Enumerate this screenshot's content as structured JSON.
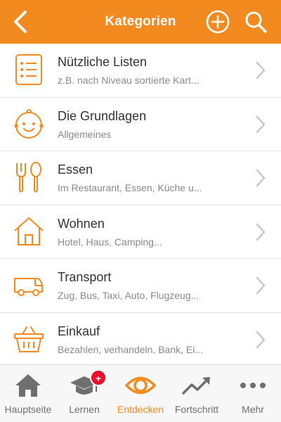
{
  "header": {
    "title": "Kategorien"
  },
  "categories": [
    {
      "title": "Nützliche Listen",
      "subtitle": "z.B. nach Niveau sortierte Kart...",
      "icon": "list-icon"
    },
    {
      "title": "Die Grundlagen",
      "subtitle": "Allgemeines",
      "icon": "baby-face-icon"
    },
    {
      "title": "Essen",
      "subtitle": "Im Restaurant, Essen, Küche u...",
      "icon": "fork-spoon-icon"
    },
    {
      "title": "Wohnen",
      "subtitle": "Hotel, Haus, Camping...",
      "icon": "house-icon"
    },
    {
      "title": "Transport",
      "subtitle": "Zug, Bus, Taxi, Auto, Flugzeug...",
      "icon": "van-icon"
    },
    {
      "title": "Einkauf",
      "subtitle": "Bezahlen, verhandeln, Bank, Ei...",
      "icon": "basket-icon"
    }
  ],
  "tabs": [
    {
      "label": "Hauptseite",
      "icon": "home-icon",
      "active": false
    },
    {
      "label": "Lernen",
      "icon": "graduation-cap-icon",
      "active": false,
      "badge": "+"
    },
    {
      "label": "Entdecken",
      "icon": "eye-icon",
      "active": true
    },
    {
      "label": "Fortschritt",
      "icon": "trend-chart-icon",
      "active": false
    },
    {
      "label": "Mehr",
      "icon": "more-dots-icon",
      "active": false
    }
  ],
  "colors": {
    "accent": "#f28a1f",
    "tabIcon": "#6f6f6f",
    "badge": "#e8102a"
  }
}
